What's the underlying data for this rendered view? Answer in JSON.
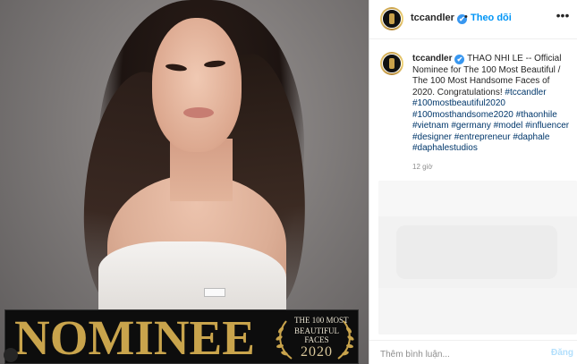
{
  "post": {
    "username": "tccandler",
    "verified_mark": "✔",
    "dot": "•",
    "follow_label": "Theo dõi",
    "more_icon": "more-options-icon"
  },
  "caption": {
    "username": "tccandler",
    "text": " THAO NHI LE -- Official Nominee for The 100 Most Beautiful / The 100 Most Handsome Faces of 2020. Congratulations! ",
    "hashtags": [
      "#tccandler",
      "#100mostbeautiful2020",
      "#100mosthandsome2020",
      "#thaonhile",
      "#vietnam",
      "#germany",
      "#model",
      "#influencer",
      "#designer",
      "#entrepreneur",
      "#daphale",
      "#daphalestudios"
    ],
    "time": "12 giờ"
  },
  "banner": {
    "word": "NOMINEE",
    "line1": "THE 100 MOST",
    "line2": "BEAUTIFUL FACES",
    "year": "2020"
  },
  "comment": {
    "placeholder": "Thêm bình luận...",
    "post_label": "Đăng"
  },
  "colors": {
    "link_blue": "#0095f6",
    "hashtag": "#00376b",
    "gold": "#c9a44c",
    "verified": "#3897f0"
  }
}
